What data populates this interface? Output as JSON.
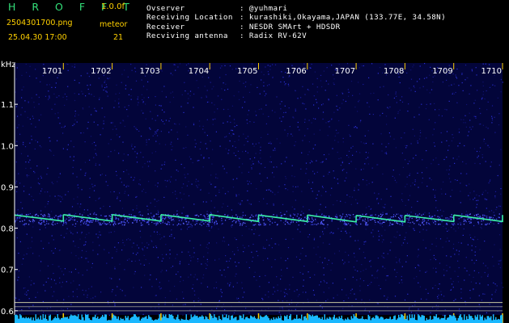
{
  "header": {
    "app_title": "H R O F F T",
    "version": "1.0.0f",
    "filename": "2504301700.png",
    "datetime": "25.04.30 17:00",
    "counter_label": "meteor",
    "counter_value": "21",
    "info_keys": [
      "Ovserver",
      "Receiving Location",
      "Receiver",
      "Recviving antenna"
    ],
    "info_values": [
      ": @yuhmari",
      ": kurashiki,Okayama,JAPAN (133.77E, 34.58N)",
      ": NESDR SMArt + HDSDR",
      ": Radix RV-62V"
    ],
    "colors": {
      "title": "#33e07a",
      "text": "#ffd000",
      "labels": "#ffffff",
      "trace": "#3af0a8",
      "background": "#000000"
    }
  },
  "chart_data": {
    "type": "heatmap",
    "title": "",
    "xlabel": "",
    "ylabel": "kHz",
    "x_ticks": [
      "1701",
      "1702",
      "1703",
      "1704",
      "1705",
      "1706",
      "1707",
      "1708",
      "1709",
      "1710"
    ],
    "y_ticks": [
      "1.1",
      "1.0",
      "0.9",
      "0.8",
      "0.7",
      "0.6"
    ],
    "y_range": [
      0.59,
      1.2
    ],
    "x_range_minutes": [
      1700,
      1710
    ],
    "signal_trace_khz": [
      {
        "x": 1700.0,
        "y": 0.822
      },
      {
        "x": 1701.0,
        "y": 0.823
      },
      {
        "x": 1702.0,
        "y": 0.823
      },
      {
        "x": 1703.0,
        "y": 0.823
      },
      {
        "x": 1704.0,
        "y": 0.823
      },
      {
        "x": 1705.0,
        "y": 0.822
      },
      {
        "x": 1706.0,
        "y": 0.822
      },
      {
        "x": 1707.0,
        "y": 0.821
      },
      {
        "x": 1708.0,
        "y": 0.821
      },
      {
        "x": 1709.0,
        "y": 0.822
      },
      {
        "x": 1710.0,
        "y": 0.822
      }
    ],
    "reference_lines_khz": [
      0.62,
      0.61,
      0.6
    ],
    "grid": false
  }
}
